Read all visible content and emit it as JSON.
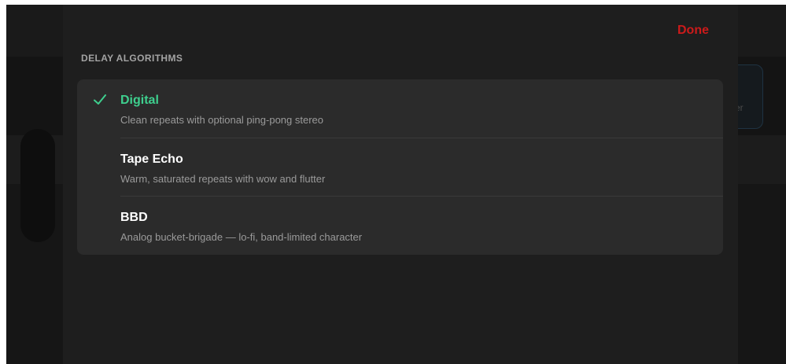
{
  "sheet": {
    "done_label": "Done",
    "section_header": "DELAY ALGORITHMS",
    "items": [
      {
        "title": "Digital",
        "subtitle": "Clean repeats with optional ping-pong stereo",
        "selected": true
      },
      {
        "title": "Tape Echo",
        "subtitle": "Warm, saturated repeats with wow and flutter",
        "selected": false
      },
      {
        "title": "BBD",
        "subtitle": "Analog bucket-brigade — lo-fi, band-limited character",
        "selected": false
      }
    ],
    "checkmark_icon": "checkmark-icon"
  },
  "background": {
    "partial_text": "er"
  },
  "colors": {
    "accent_green": "#3ecf8e",
    "done_red": "#cc1a1a",
    "sheet_bg": "#1e1e1e",
    "card_bg": "#2b2b2b"
  }
}
